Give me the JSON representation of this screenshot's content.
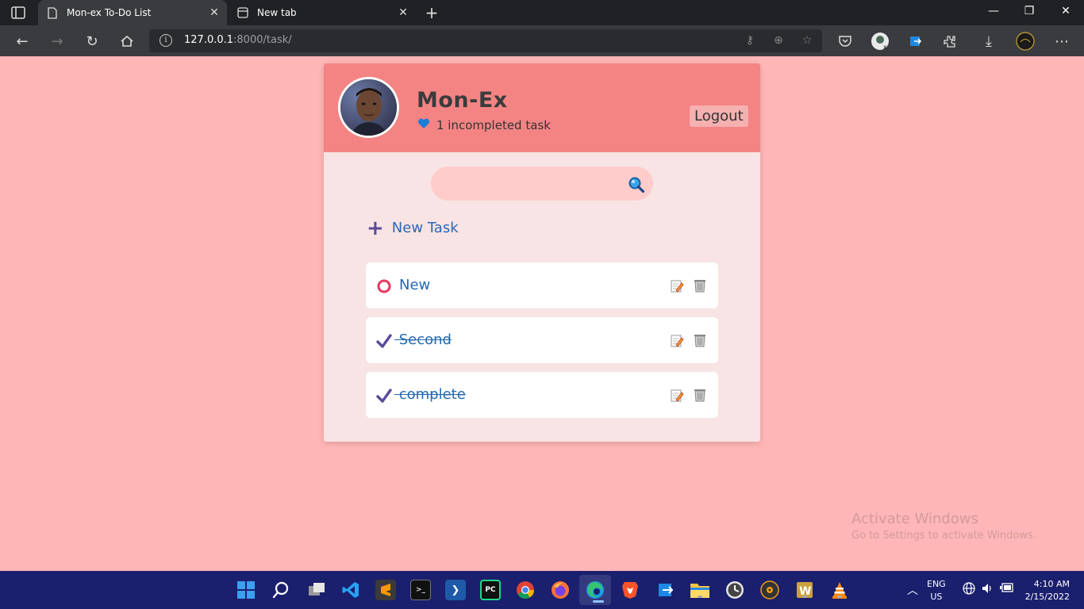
{
  "browser": {
    "tabs": [
      {
        "label": "Mon-ex To-Do List",
        "active": true,
        "icon": "page-icon"
      },
      {
        "label": "New tab",
        "active": false,
        "icon": "newtab-grid-icon"
      }
    ],
    "url_host": "127.0.0.1",
    "url_path": ":8000/task/"
  },
  "header": {
    "user_name": "Mon-Ex",
    "incomplete_text": "1 incompleted task",
    "logout_label": "Logout"
  },
  "search": {
    "placeholder": ""
  },
  "new_task_label": "New Task",
  "tasks": [
    {
      "title": "New",
      "completed": false
    },
    {
      "title": "Second",
      "completed": true
    },
    {
      "title": "complete",
      "completed": true
    }
  ],
  "watermark": {
    "line1": "Activate Windows",
    "line2": "Go to Settings to activate Windows."
  },
  "system": {
    "lang_line1": "ENG",
    "lang_line2": "US",
    "time": "4:10 AM",
    "date": "2/15/2022"
  },
  "colors": {
    "page_bg": "#ffb6b6",
    "header_bg": "#f48484",
    "accent_blue": "#2469b0",
    "incomplete_ring": "#e8385c",
    "check_purple": "#5b4a9a"
  }
}
